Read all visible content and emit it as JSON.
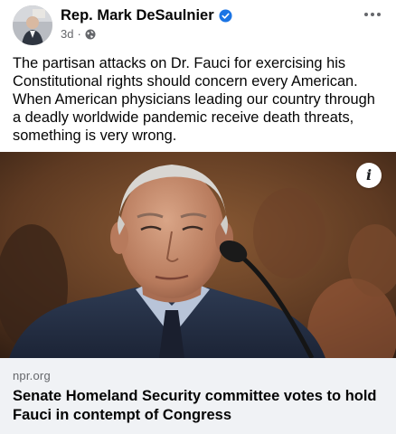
{
  "header": {
    "author": "Rep. Mark DeSaulnier",
    "timestamp": "3d",
    "separator": "·",
    "verified_icon": "verified-badge-icon",
    "privacy_icon": "globe-icon",
    "more_icon": "more-options-icon"
  },
  "post": {
    "text": "The partisan attacks on Dr. Fauci for exercising his Constitutional rights should concern every American. When American physicians leading our country through a deadly worldwide pandemic receive death threats, something is very wrong."
  },
  "photo": {
    "info_label": "i",
    "info_icon": "info-icon"
  },
  "link_preview": {
    "source": "npr.org",
    "headline": "Senate Homeland Security committee votes to hold Fauci in contempt of Congress"
  },
  "colors": {
    "verified_blue": "#1b74e4",
    "secondary_text": "#65676b",
    "link_box_bg": "#f0f2f5"
  }
}
